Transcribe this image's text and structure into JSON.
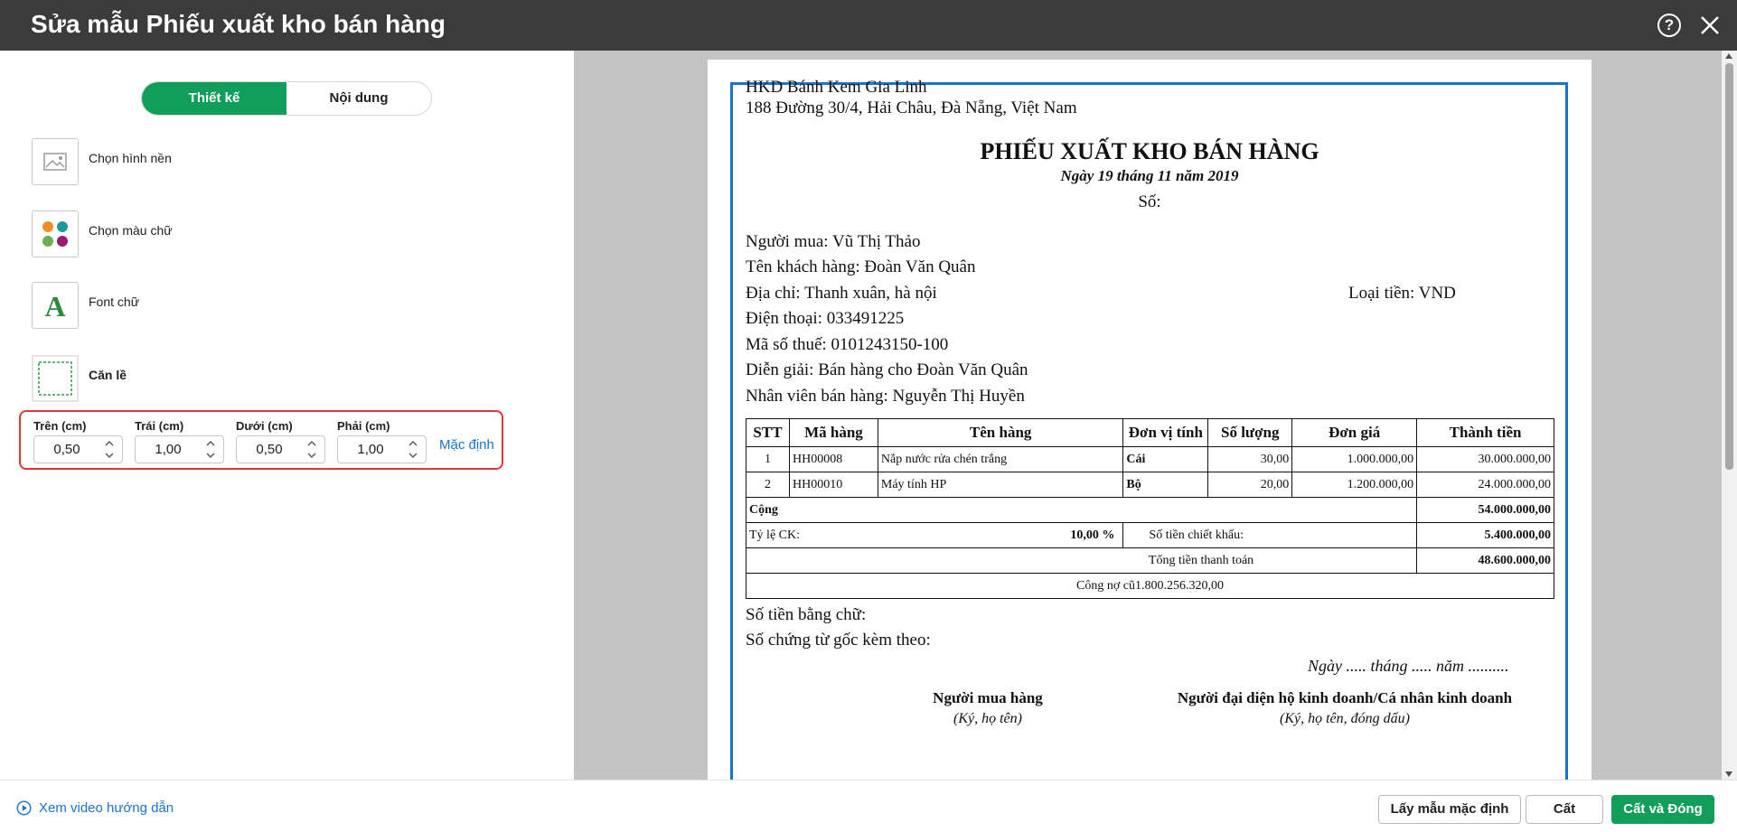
{
  "window": {
    "title": "Sửa mẫu Phiếu xuất kho bán hàng",
    "help_icon": "help-circle-icon",
    "close_icon": "close-icon"
  },
  "left_panel": {
    "tabs": [
      {
        "label": "Thiết kế",
        "active": true
      },
      {
        "label": "Nội dung",
        "active": false
      }
    ],
    "options": [
      {
        "label": "Chọn hình nền",
        "icon": "image-icon"
      },
      {
        "label": "Chọn màu chữ",
        "icon": "color-palette-icon"
      },
      {
        "label": "Font chữ",
        "icon": "font-icon"
      },
      {
        "label": "Căn lề",
        "icon": "margin-icon"
      }
    ],
    "margins": {
      "top_label": "Trên (cm)",
      "top_value": "0,50",
      "left_label": "Trái (cm)",
      "left_value": "1,00",
      "bottom_label": "Dưới (cm)",
      "bottom_value": "0,50",
      "right_label": "Phải (cm)",
      "right_value": "1,00",
      "default_link": "Mặc định"
    }
  },
  "document": {
    "company": "HKD Bánh Kem Gia Linh",
    "address": "188 Đường 30/4, Hải Châu, Đà Nẵng, Việt Nam",
    "title": "PHIẾU XUẤT KHO BÁN HÀNG",
    "date": "Ngày 19 tháng 11 năm 2019",
    "number_label": "Số:",
    "buyer": "Người mua: Vũ Thị Thảo",
    "customer": "Tên khách hàng: Đoàn Văn Quân",
    "address_line": "Địa chỉ: Thanh xuân, hà nội",
    "currency": "Loại tiền: VND",
    "phone": "Điện thoại: 033491225",
    "tax_code": "Mã số thuế: 0101243150-100",
    "description": "Diễn giải: Bán hàng cho Đoàn Văn Quân",
    "salesperson": "Nhân viên bán hàng: Nguyễn Thị Huyền",
    "table": {
      "headers": [
        "STT",
        "Mã hàng",
        "Tên hàng",
        "Đơn vị tính",
        "Số lượng",
        "Đơn giá",
        "Thành tiền"
      ],
      "rows": [
        {
          "stt": "1",
          "code": "HH00008",
          "name": "Nắp nước rửa chén trắng",
          "unit": "Cái",
          "qty": "30,00",
          "price": "1.000.000,00",
          "amount": "30.000.000,00"
        },
        {
          "stt": "2",
          "code": "HH00010",
          "name": "Máy tính HP",
          "unit": "Bộ",
          "qty": "20,00",
          "price": "1.200.000,00",
          "amount": "24.000.000,00"
        }
      ],
      "total_label": "Cộng",
      "total_value": "54.000.000,00",
      "discount_rate_label": "Tỷ lệ CK:",
      "discount_rate_value": "10,00 %",
      "discount_amount_label": "Số tiền chiết khấu:",
      "discount_amount_value": "5.400.000,00",
      "payment_label": "Tổng tiền thanh toán",
      "payment_value": "48.600.000,00",
      "old_debt": "Công nợ cũ1.800.256.320,00"
    },
    "amount_in_words": "Số tiền bằng chữ:",
    "attached_docs": "Số chứng từ gốc kèm theo:",
    "sign_date": "Ngày ..... tháng ..... năm ..........",
    "buyer_sign_title": "Người mua hàng",
    "buyer_sign_sub": "(Ký, họ tên)",
    "rep_sign_title": "Người đại diện hộ kinh doanh/Cá nhân kinh doanh",
    "rep_sign_sub": "(Ký, họ tên, đóng dấu)"
  },
  "footer": {
    "video_link": "Xem video hướng dẫn",
    "btn_default": "Lấy mẫu mặc định",
    "btn_save": "Cất",
    "btn_save_close": "Cất và Đóng"
  },
  "colors": {
    "accent": "#119d5a",
    "link": "#1a73d0",
    "titlebar": "#3b3b3b",
    "highlight_border": "#e0353b",
    "page_frame": "#1a73c9"
  }
}
